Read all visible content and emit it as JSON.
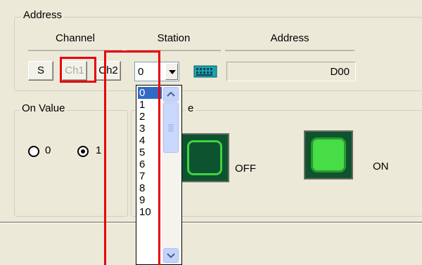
{
  "address_group": {
    "legend": "Address",
    "channel_header": "Channel",
    "station_header": "Station",
    "address_header": "Address",
    "s_button": "S",
    "ch1_button": "Ch1",
    "ch2_button": "Ch2",
    "station_value": "0",
    "keypad_icon": "keypad-icon",
    "address_value": "D00"
  },
  "station_dropdown": {
    "options": [
      "0",
      "1",
      "2",
      "3",
      "4",
      "5",
      "6",
      "7",
      "8",
      "9",
      "10"
    ],
    "selected": "0"
  },
  "on_value_group": {
    "legend": "On Value",
    "options": [
      {
        "label": "0",
        "checked": false
      },
      {
        "label": "1",
        "checked": true
      }
    ]
  },
  "style_group": {
    "legend_tail": "e",
    "lamps": [
      {
        "label": "OFF",
        "state": "off"
      },
      {
        "label": "ON",
        "state": "on"
      }
    ]
  },
  "colors": {
    "highlight": "#e8000b",
    "lamp_bg": "#0e5330",
    "lamp_on": "#47dd47",
    "selection": "#316ac5"
  }
}
